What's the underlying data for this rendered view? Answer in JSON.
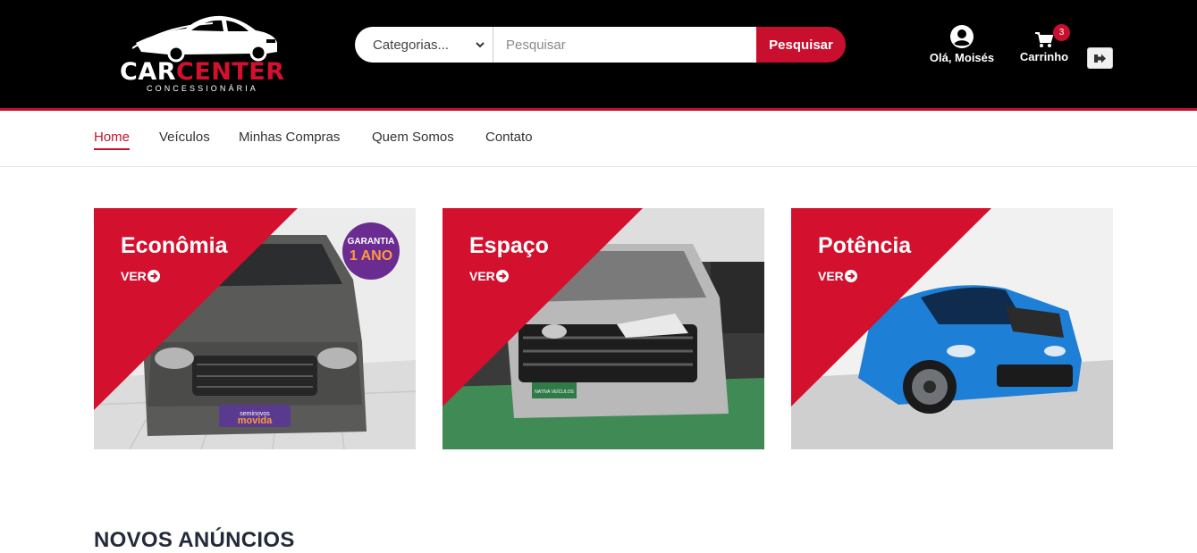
{
  "brand": {
    "name_part1": "CAR",
    "name_part2": "CENTER",
    "tagline": "CONCESSIONÁRIA"
  },
  "search": {
    "category_label": "Categorias...",
    "placeholder": "Pesquisar",
    "button_label": "Pesquisar"
  },
  "user": {
    "greeting": "Olá, Moisés"
  },
  "cart": {
    "label": "Carrinho",
    "count": "3"
  },
  "nav": {
    "items": [
      {
        "label": "Home"
      },
      {
        "label": "Veículos"
      },
      {
        "label": "Minhas Compras"
      },
      {
        "label": "Quem Somos"
      },
      {
        "label": "Contato"
      }
    ]
  },
  "categories": [
    {
      "title": "Econômia",
      "link": "VER"
    },
    {
      "title": "Espaço",
      "link": "VER"
    },
    {
      "title": "Potência",
      "link": "VER"
    }
  ],
  "promo_badge": {
    "line1": "GARANTIA",
    "line2": "1 ANO"
  },
  "car_badges": {
    "movida_small": "seminovos",
    "movida_big": "movida",
    "plate_espaco": "NATIVA VEÍCULOS"
  },
  "sections": {
    "new_listings": "NOVOS ANÚNCIOS"
  },
  "colors": {
    "brand_red": "#c8102e",
    "header_bg": "#000000"
  }
}
